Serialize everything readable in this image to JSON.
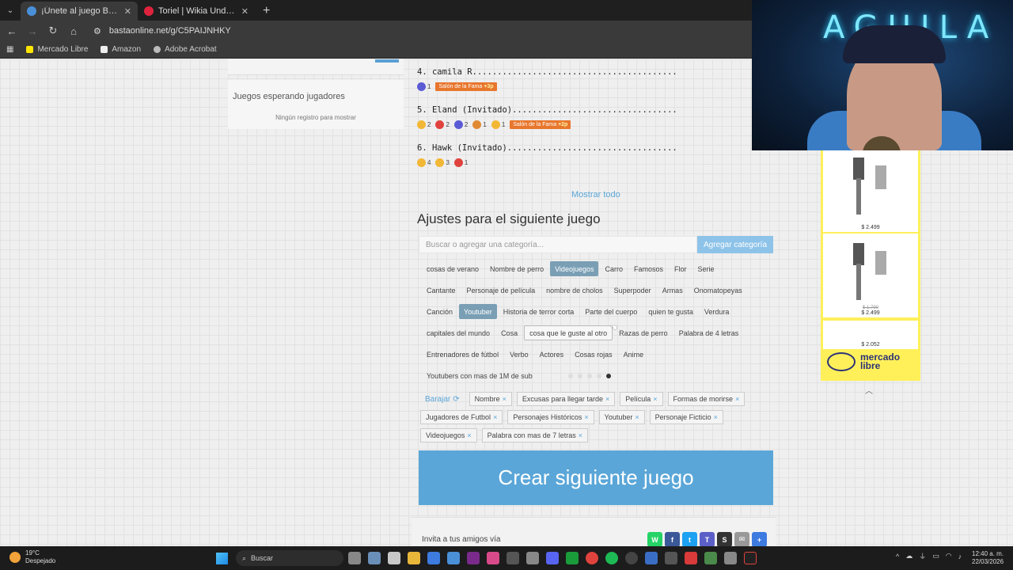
{
  "browser": {
    "tabs": [
      {
        "label": "¡Únete al juego Basta!",
        "active": true,
        "icon_color": "#4a90d9"
      },
      {
        "label": "Toriel | Wikia Undertale | Fandom",
        "active": false,
        "icon_color": "#e0233d"
      }
    ],
    "url": "bastaonline.net/g/C5PAIJNHKY",
    "bookmarks": [
      {
        "label": "Mercado Libre",
        "icon": "mercadolibre-icon"
      },
      {
        "label": "Amazon",
        "icon": "amazon-icon"
      },
      {
        "label": "Adobe Acrobat",
        "icon": "acrobat-icon"
      }
    ]
  },
  "waiting": {
    "title": "Juegos esperando jugadores",
    "empty": "Ningún registro para mostrar"
  },
  "scores": [
    {
      "name": "4. camila R.........................................",
      "reactions": [
        {
          "icon": "like-icon",
          "count": "1",
          "color": "#5b5bd6"
        }
      ],
      "fame_label": "Salón de la Fama ",
      "fame_points": "+3p"
    },
    {
      "name": "5. Eland (Invitado).................................",
      "reactions": [
        {
          "icon": "wow-icon",
          "count": "2",
          "color": "#f2b734"
        },
        {
          "icon": "heart-icon",
          "count": "2",
          "color": "#e0433d"
        },
        {
          "icon": "like-icon",
          "count": "2",
          "color": "#5b5bd6"
        },
        {
          "icon": "angry-icon",
          "count": "1",
          "color": "#e08a34"
        },
        {
          "icon": "laugh-icon",
          "count": "1",
          "color": "#f2b734"
        }
      ],
      "fame_label": "Salón de la Fama ",
      "fame_points": "+2p"
    },
    {
      "name": "6. Hawk (Invitado)..................................",
      "reactions": [
        {
          "icon": "laugh-icon",
          "count": "4",
          "color": "#f2b734"
        },
        {
          "icon": "wow-icon",
          "count": "3",
          "color": "#f2b734"
        },
        {
          "icon": "heart-icon",
          "count": "1",
          "color": "#e0433d"
        }
      ],
      "fame_label": "",
      "fame_points": ""
    }
  ],
  "show_all": "Mostrar todo",
  "settings": {
    "title": "Ajustes para el siguiente juego",
    "category_placeholder": "Buscar o agregar una categoría...",
    "add_button": "Agregar categoría"
  },
  "category_rows": [
    [
      {
        "label": "cosas de verano"
      },
      {
        "label": "Nombre de perro"
      },
      {
        "label": "Videojuegos",
        "selected": true
      },
      {
        "label": "Carro"
      },
      {
        "label": "Famosos"
      },
      {
        "label": "Flor"
      },
      {
        "label": "Serie"
      }
    ],
    [
      {
        "label": "Cantante"
      },
      {
        "label": "Personaje de película"
      },
      {
        "label": "nombre de cholos"
      },
      {
        "label": "Superpoder"
      },
      {
        "label": "Armas"
      },
      {
        "label": "Onomatopeyas"
      }
    ],
    [
      {
        "label": "Canción"
      },
      {
        "label": "Youtuber",
        "selected": true
      },
      {
        "label": "Historia de terror corta"
      },
      {
        "label": "Parte del cuerpo"
      },
      {
        "label": "quien te gusta"
      },
      {
        "label": "Verdura"
      }
    ],
    [
      {
        "label": "capitales del mundo"
      },
      {
        "label": "Cosa"
      },
      {
        "label": "cosa que le guste al otro",
        "hover": true
      },
      {
        "label": "Razas de perro"
      },
      {
        "label": "Palabra de 4 letras"
      }
    ],
    [
      {
        "label": "Entrenadores de fútbol"
      },
      {
        "label": "Verbo"
      },
      {
        "label": "Actores"
      },
      {
        "label": "Cosas rojas"
      },
      {
        "label": "Anime"
      }
    ],
    [
      {
        "label": "Youtubers con mas de 1M de sub"
      }
    ]
  ],
  "pagination": {
    "count": 5,
    "active": 4
  },
  "chosen": {
    "shuffle_label": "Barajar",
    "tags": [
      "Nombre",
      "Excusas para llegar tarde",
      "Película",
      "Formas de morirse",
      "Jugadores de Futbol",
      "Personajes Históricos",
      "Youtuber",
      "Personaje Ficticio",
      "Videojuegos",
      "Palabra con mas de 7 letras"
    ]
  },
  "create_button": "Crear siguiente juego",
  "invite": "Invita a tus amigos vía",
  "share_icons": [
    {
      "name": "whatsapp-icon",
      "color": "#25d366",
      "glyph": "W"
    },
    {
      "name": "facebook-icon",
      "color": "#3b5998",
      "glyph": "f"
    },
    {
      "name": "twitter-icon",
      "color": "#1da1f2",
      "glyph": "t"
    },
    {
      "name": "teams-icon",
      "color": "#5b5fc7",
      "glyph": "T"
    },
    {
      "name": "snapchat-icon",
      "color": "#333333",
      "glyph": "S"
    },
    {
      "name": "email-icon",
      "color": "#999999",
      "glyph": "✉"
    },
    {
      "name": "more-share-icon",
      "color": "#3d7be0",
      "glyph": "+"
    }
  ],
  "ad": {
    "prices": [
      {
        "old": "",
        "new": "$ 2.499"
      },
      {
        "old": "$ 1.790",
        "new": "$ 2.499"
      },
      {
        "old": "",
        "new": "$ 2.052"
      }
    ],
    "brand": "mercado\nlibre"
  },
  "taskbar": {
    "weather_temp": "19°C",
    "weather_desc": "Despejado",
    "search_label": "Buscar",
    "time": "12:40 a. m.",
    "date": "22/03/2026"
  },
  "webcam": {
    "neon_text": "AGUILA"
  }
}
